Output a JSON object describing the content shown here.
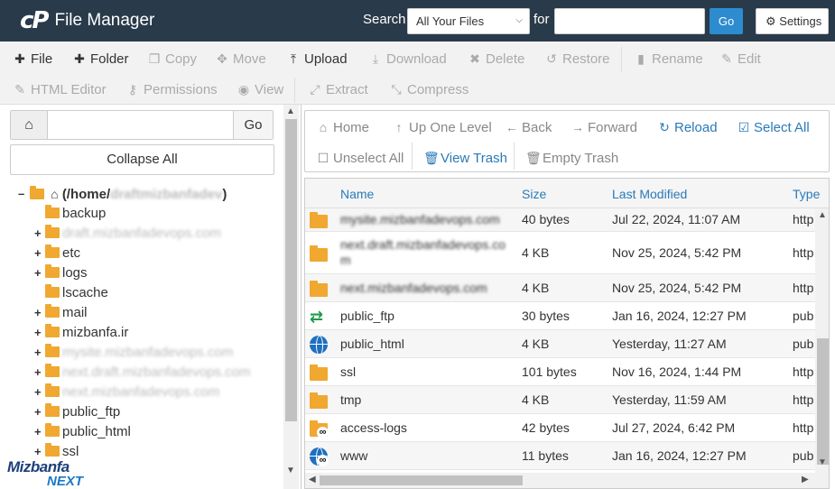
{
  "header": {
    "logo_text": "cP",
    "app_title": "File Manager",
    "search_label": "Search",
    "search_scope": "All Your Files",
    "for_label": "for",
    "search_query": "",
    "go_label": "Go",
    "settings_label": "Settings"
  },
  "toolbar": {
    "file": "File",
    "folder": "Folder",
    "copy": "Copy",
    "move": "Move",
    "upload": "Upload",
    "download": "Download",
    "delete": "Delete",
    "restore": "Restore",
    "rename": "Rename",
    "edit": "Edit",
    "html_editor": "HTML Editor",
    "permissions": "Permissions",
    "view": "View",
    "extract": "Extract",
    "compress": "Compress"
  },
  "left_panel": {
    "path_value": "",
    "go_label": "Go",
    "collapse_all": "Collapse All",
    "root_label": "(/home/",
    "root_user": "draftmizbanfadev",
    "root_close": ")",
    "tree": [
      {
        "name": "backup",
        "blurred": false,
        "expandable": false
      },
      {
        "name": "draft.mizbanfadevops.com",
        "blurred": true,
        "expandable": true
      },
      {
        "name": "etc",
        "blurred": false,
        "expandable": true
      },
      {
        "name": "logs",
        "blurred": false,
        "expandable": true
      },
      {
        "name": "lscache",
        "blurred": false,
        "expandable": false
      },
      {
        "name": "mail",
        "blurred": false,
        "expandable": true
      },
      {
        "name": "mizbanfa.ir",
        "blurred": false,
        "expandable": true
      },
      {
        "name": "mysite.mizbanfadevops.com",
        "blurred": true,
        "expandable": true
      },
      {
        "name": "next.draft.mizbanfadevops.com",
        "blurred": true,
        "expandable": true
      },
      {
        "name": "next.mizbanfadevops.com",
        "blurred": true,
        "expandable": true
      },
      {
        "name": "public_ftp",
        "blurred": false,
        "expandable": true
      },
      {
        "name": "public_html",
        "blurred": false,
        "expandable": true
      },
      {
        "name": "ssl",
        "blurred": false,
        "expandable": true
      }
    ]
  },
  "nav": {
    "home": "Home",
    "up_one_level": "Up One Level",
    "back": "Back",
    "forward": "Forward",
    "reload": "Reload",
    "select_all": "Select All",
    "unselect_all": "Unselect All",
    "view_trash": "View Trash",
    "empty_trash": "Empty Trash"
  },
  "table": {
    "columns": [
      "Name",
      "Size",
      "Last Modified",
      "Type"
    ],
    "rows": [
      {
        "name": "mysite.mizbanfadevops.com",
        "name_line2": "",
        "blurred": true,
        "icon": "folder",
        "size": "40 bytes",
        "modified": "Jul 22, 2024, 11:07 AM",
        "type": "http"
      },
      {
        "name": "next.draft.mizbanfadevops.co",
        "name_line2": "m",
        "blurred": true,
        "icon": "folder",
        "size": "4 KB",
        "modified": "Nov 25, 2024, 5:42 PM",
        "type": "http"
      },
      {
        "name": "next.mizbanfadevops.com",
        "name_line2": "",
        "blurred": true,
        "icon": "folder",
        "size": "4 KB",
        "modified": "Nov 25, 2024, 5:42 PM",
        "type": "http"
      },
      {
        "name": "public_ftp",
        "name_line2": "",
        "blurred": false,
        "icon": "ftp",
        "size": "30 bytes",
        "modified": "Jan 16, 2024, 12:27 PM",
        "type": "pub"
      },
      {
        "name": "public_html",
        "name_line2": "",
        "blurred": false,
        "icon": "globe",
        "size": "4 KB",
        "modified": "Yesterday, 11:27 AM",
        "type": "pub"
      },
      {
        "name": "ssl",
        "name_line2": "",
        "blurred": false,
        "icon": "folder",
        "size": "101 bytes",
        "modified": "Nov 16, 2024, 1:44 PM",
        "type": "http"
      },
      {
        "name": "tmp",
        "name_line2": "",
        "blurred": false,
        "icon": "folder",
        "size": "4 KB",
        "modified": "Yesterday, 11:59 AM",
        "type": "http"
      },
      {
        "name": "access-logs",
        "name_line2": "",
        "blurred": false,
        "icon": "folder-link",
        "size": "42 bytes",
        "modified": "Jul 27, 2024, 6:42 PM",
        "type": "http"
      },
      {
        "name": "www",
        "name_line2": "",
        "blurred": false,
        "icon": "globe-link",
        "size": "11 bytes",
        "modified": "Jan 16, 2024, 12:27 PM",
        "type": "pub"
      }
    ]
  },
  "watermark": {
    "line1": "Mizbanfa",
    "line2": "NEXT"
  },
  "colors": {
    "header_bg": "#293a4a",
    "accent_blue": "#2d8ccf",
    "link_blue": "#2a7ab8",
    "folder": "#f0a830",
    "ftp_green": "#1f9a4b"
  }
}
